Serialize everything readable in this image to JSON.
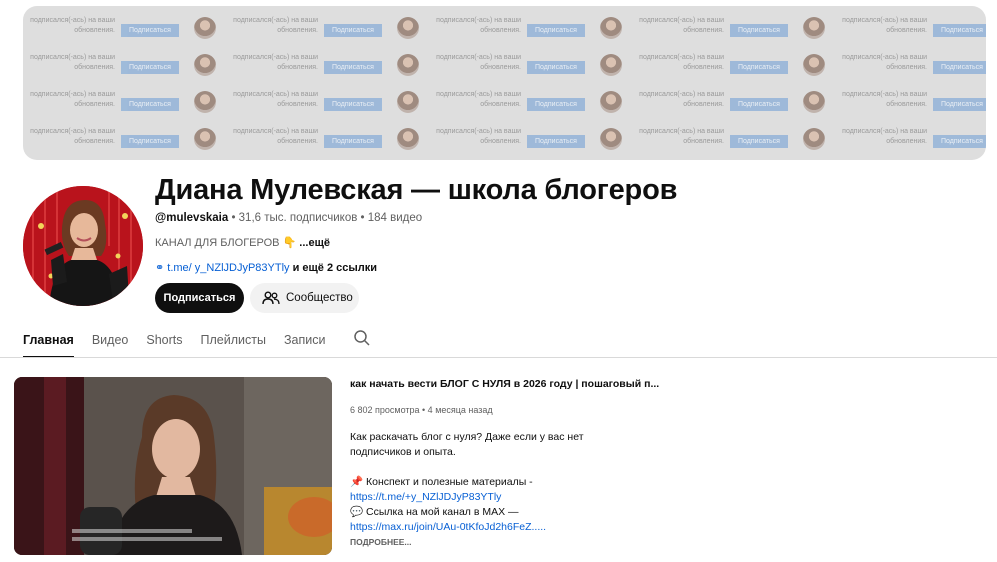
{
  "banner": {
    "follow_text": "подписался(-ась) на ваши обновления.",
    "follow_button": "Подписаться"
  },
  "channel": {
    "name": "Диана Мулевская — школа блогеров",
    "handle": "@mulevskaia",
    "subscribers": "• 31,6 тыс. подписчиков • 184 видео",
    "description": "КАНАЛ ДЛЯ БЛОГЕРОВ 👇",
    "description_more": " ...ещё",
    "link_text": "t.me/ y_NZlJDJyP83YTly",
    "link_rest": " и ещё 2 ссылки",
    "subscribe_label": "Подписаться",
    "community_label": "Сообщество"
  },
  "tabs": [
    {
      "label": "Главная",
      "active": true
    },
    {
      "label": "Видео",
      "active": false
    },
    {
      "label": "Shorts",
      "active": false
    },
    {
      "label": "Плейлисты",
      "active": false
    },
    {
      "label": "Записи",
      "active": false
    }
  ],
  "featured_video": {
    "title": "как начать вести БЛОГ С НУЛЯ в 2026 году | пошаговый п...",
    "views_age": "6 802 просмотра • 4 месяца назад",
    "desc_line1": "Как раскачать блог с нуля? Даже если у вас нет",
    "desc_line2": "подписчиков и опыта.",
    "desc_line3": "📌 Конспект и полезные материалы -",
    "desc_line4": "https://t.me/+y_NZlJDJyP83YTly",
    "desc_line5": "💬 Ссылка на мой канал в MAX —",
    "desc_line6": "https://max.ru/join/UAu-0tKfoJd2h6FeZ.....",
    "more_label": "ПОДРОБНЕЕ..."
  },
  "colors": {
    "link": "#065fd4",
    "subscribe_bg": "#0f0f0f",
    "avatar_bg": "#b9131c"
  }
}
